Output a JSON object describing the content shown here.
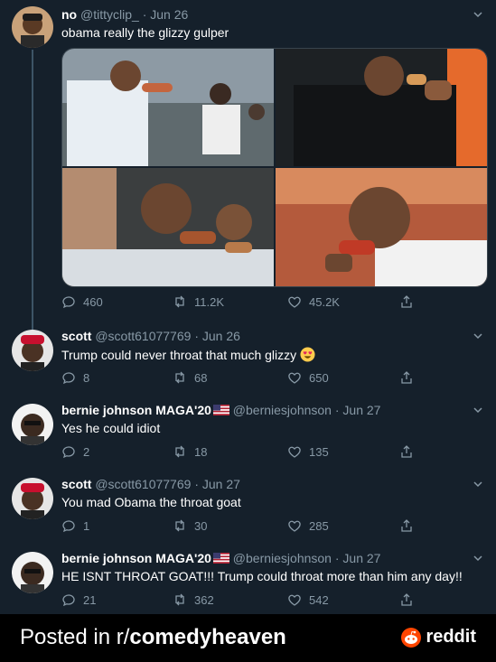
{
  "tweets": [
    {
      "name": "no",
      "handle": "@tittyclip_",
      "date": "Jun 26",
      "text": "obama really the glizzy gulper",
      "replies": "460",
      "retweets": "11.2K",
      "likes": "45.2K"
    },
    {
      "name": "scott",
      "handle": "@scott61077769",
      "date": "Jun 26",
      "text": "Trump could never throat that much glizzy",
      "replies": "8",
      "retweets": "68",
      "likes": "650"
    },
    {
      "name": "bernie johnson MAGA'20",
      "handle": "@berniesjohnson",
      "date": "Jun 27",
      "text": "Yes he could idiot",
      "replies": "2",
      "retweets": "18",
      "likes": "135"
    },
    {
      "name": "scott",
      "handle": "@scott61077769",
      "date": "Jun 27",
      "text": "You mad Obama the throat goat",
      "replies": "1",
      "retweets": "30",
      "likes": "285"
    },
    {
      "name": "bernie johnson MAGA'20",
      "handle": "@berniesjohnson",
      "date": "Jun 27",
      "text": "HE ISNT THROAT GOAT!!! Trump could throat more than him any day!!",
      "replies": "21",
      "retweets": "362",
      "likes": "542"
    }
  ],
  "separator": "·",
  "footer": {
    "prefix": "Posted in r/",
    "subreddit": "comedyheaven",
    "brand": "reddit"
  },
  "colors": {
    "background": "#15202b",
    "secondary_text": "#8899a6",
    "footer_bg": "#000000",
    "reddit_orange": "#ff4500"
  }
}
